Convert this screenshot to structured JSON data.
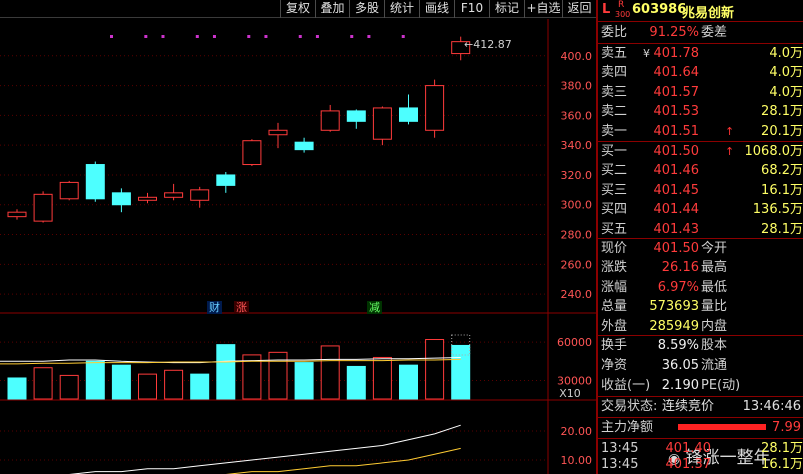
{
  "toolbar": {
    "items": [
      "复权",
      "叠加",
      "多股",
      "统计",
      "画线",
      "F10",
      "标记",
      "+自选",
      "返回"
    ]
  },
  "main_chart": {
    "price_axis": [
      "400.0",
      "380.0",
      "360.0",
      "340.0",
      "320.0",
      "300.0",
      "280.0",
      "260.0",
      "240.0"
    ],
    "high_marker": "412.87",
    "event_markers": [
      "财",
      "涨",
      "减"
    ]
  },
  "volume_chart": {
    "axis": [
      "60000",
      "30000",
      "X10"
    ]
  },
  "indicator_chart": {
    "axis": [
      "20.00",
      "10.00"
    ]
  },
  "chart_data": {
    "type": "candlestick",
    "ylim": [
      230,
      418
    ],
    "candles": [
      {
        "o": 292,
        "c": 295,
        "h": 297,
        "l": 290
      },
      {
        "o": 289,
        "c": 307,
        "h": 309,
        "l": 288
      },
      {
        "o": 304,
        "c": 315,
        "h": 316,
        "l": 303
      },
      {
        "o": 327,
        "c": 304,
        "h": 329,
        "l": 302
      },
      {
        "o": 308,
        "c": 300,
        "h": 311,
        "l": 295
      },
      {
        "o": 303,
        "c": 305,
        "h": 308,
        "l": 301
      },
      {
        "o": 305,
        "c": 308,
        "h": 314,
        "l": 303
      },
      {
        "o": 303,
        "c": 310,
        "h": 312,
        "l": 298
      },
      {
        "o": 320,
        "c": 313,
        "h": 322,
        "l": 308
      },
      {
        "o": 327,
        "c": 343,
        "h": 344,
        "l": 326
      },
      {
        "o": 347,
        "c": 350,
        "h": 355,
        "l": 338
      },
      {
        "o": 342,
        "c": 337,
        "h": 345,
        "l": 335
      },
      {
        "o": 350,
        "c": 363,
        "h": 367,
        "l": 349
      },
      {
        "o": 363,
        "c": 356,
        "h": 364,
        "l": 351
      },
      {
        "o": 344,
        "c": 365,
        "h": 366,
        "l": 340
      },
      {
        "o": 365,
        "c": 356,
        "h": 374,
        "l": 354
      },
      {
        "o": 350,
        "c": 380,
        "h": 384,
        "l": 345
      },
      {
        "o": 401.5,
        "c": 409.5,
        "h": 412.87,
        "l": 397
      }
    ],
    "volumes": [
      {
        "v": 32000,
        "up": false
      },
      {
        "v": 40000,
        "up": true
      },
      {
        "v": 34000,
        "up": true
      },
      {
        "v": 45000,
        "up": false
      },
      {
        "v": 42000,
        "up": false
      },
      {
        "v": 35000,
        "up": true
      },
      {
        "v": 38000,
        "up": true
      },
      {
        "v": 35000,
        "up": false
      },
      {
        "v": 58000,
        "up": false
      },
      {
        "v": 50000,
        "up": true
      },
      {
        "v": 52000,
        "up": true
      },
      {
        "v": 44000,
        "up": false
      },
      {
        "v": 57000,
        "up": true
      },
      {
        "v": 41000,
        "up": false
      },
      {
        "v": 48000,
        "up": true
      },
      {
        "v": 42000,
        "up": false
      },
      {
        "v": 62000,
        "up": true
      },
      {
        "v": 57369,
        "up": false
      }
    ],
    "volume_ylim": [
      0,
      78000
    ],
    "volume_ma": [
      [
        45000,
        45000,
        46000,
        46000,
        45000,
        44500,
        44000,
        44000,
        45000,
        45500,
        46000,
        46000,
        46500,
        46500,
        47000,
        47000,
        47500,
        48000
      ],
      [
        43000,
        43500,
        43500,
        44000,
        44000,
        44000,
        44500,
        44500,
        44500,
        45000,
        45000,
        45000,
        45500,
        45500,
        45500,
        46000,
        46000,
        46500
      ]
    ],
    "indicator_lines": [
      [
        4,
        5,
        5,
        6,
        6,
        7,
        7,
        8,
        9,
        10,
        11,
        12,
        13,
        14,
        15,
        17,
        19,
        22
      ],
      [
        2,
        2,
        3,
        3,
        3,
        4,
        4,
        4,
        5,
        6,
        6,
        7,
        8,
        8,
        9,
        10,
        12,
        14
      ]
    ],
    "indicator_ylim": [
      0,
      30
    ]
  },
  "quote": {
    "flag": "L",
    "r_mark": "R",
    "r_sub": "300",
    "code": "603986",
    "name": "兆易创新",
    "webi_label": "委比",
    "webi_value": "91.25%",
    "weicha_label": "委差",
    "weicha_value": "",
    "asks": [
      {
        "label": "卖五",
        "mark": "¥",
        "price": "401.78",
        "vol": "4.0万"
      },
      {
        "label": "卖四",
        "mark": "",
        "price": "401.64",
        "vol": "4.0万"
      },
      {
        "label": "卖三",
        "mark": "",
        "price": "401.57",
        "vol": "4.0万"
      },
      {
        "label": "卖二",
        "mark": "",
        "price": "401.53",
        "vol": "28.1万"
      },
      {
        "label": "卖一",
        "mark": "↑",
        "price": "401.51",
        "vol": "20.1万"
      }
    ],
    "bids": [
      {
        "label": "买一",
        "mark": "↑",
        "price": "401.50",
        "vol": "1068.0万"
      },
      {
        "label": "买二",
        "mark": "",
        "price": "401.46",
        "vol": "68.2万"
      },
      {
        "label": "买三",
        "mark": "",
        "price": "401.45",
        "vol": "16.1万"
      },
      {
        "label": "买四",
        "mark": "",
        "price": "401.44",
        "vol": "136.5万"
      },
      {
        "label": "买五",
        "mark": "",
        "price": "401.43",
        "vol": "28.1万"
      }
    ],
    "stats": [
      {
        "l1": "现价",
        "v1": "401.50",
        "l2": "今开",
        "v2": ""
      },
      {
        "l1": "涨跌",
        "v1": "26.16",
        "l2": "最高",
        "v2": ""
      },
      {
        "l1": "涨幅",
        "v1": "6.97%",
        "l2": "最低",
        "v2": ""
      },
      {
        "l1": "总量",
        "v1": "573693",
        "l2": "量比",
        "v2": ""
      },
      {
        "l1": "外盘",
        "v1": "285949",
        "l2": "内盘",
        "v2": ""
      }
    ],
    "stats2": [
      {
        "l1": "换手",
        "v1": "8.59%",
        "l2": "股本",
        "v2": ""
      },
      {
        "l1": "净资",
        "v1": "36.05",
        "l2": "流通",
        "v2": ""
      },
      {
        "l1": "收益(一)",
        "v1": "2.190",
        "l2": "PE(动)",
        "v2": ""
      }
    ],
    "trade_status_label": "交易状态:",
    "trade_status_value": "连续竞价",
    "trade_time": "13:46:46",
    "main_net_label": "主力净额",
    "main_net_value": "7.99",
    "ticks": [
      {
        "time": "13:45",
        "price": "401.40",
        "vol": "28.1万"
      },
      {
        "time": "13:45",
        "price": "401.37",
        "vol": "16.1万"
      }
    ],
    "watermark": "锋涨一整年"
  }
}
